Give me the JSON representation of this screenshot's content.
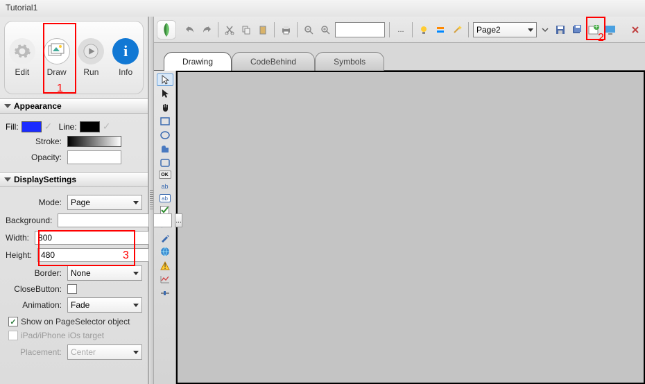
{
  "title": "Tutorial1",
  "modes": {
    "edit": "Edit",
    "draw": "Draw",
    "run": "Run",
    "info": "Info"
  },
  "annotations": {
    "one": "1",
    "two": "2",
    "three": "3"
  },
  "appearance": {
    "header": "Appearance",
    "fill": "Fill:",
    "line": "Line:",
    "stroke": "Stroke:",
    "opacity": "Opacity:",
    "opacity_val": ""
  },
  "display": {
    "header": "DisplaySettings",
    "mode_lbl": "Mode:",
    "mode_val": "Page",
    "bg_lbl": "Background:",
    "bg_val": "",
    "width_lbl": "Width:",
    "width_val": "800",
    "height_lbl": "Height:",
    "height_val": "480",
    "border_lbl": "Border:",
    "border_val": "None",
    "close_lbl": "CloseButton:",
    "anim_lbl": "Animation:",
    "anim_val": "Fade",
    "show_ps": "Show on PageSelector object",
    "ios_target": "iPad/iPhone iOs target",
    "placement_lbl": "Placement:",
    "placement_val": "Center"
  },
  "toolbar": {
    "page": "Page2",
    "search": "",
    "more": "..."
  },
  "tabs": {
    "drawing": "Drawing",
    "codebehind": "CodeBehind",
    "symbols": "Symbols"
  },
  "tools": {
    "ok": "OK",
    "ab": "ab",
    "abbox": "ab"
  }
}
